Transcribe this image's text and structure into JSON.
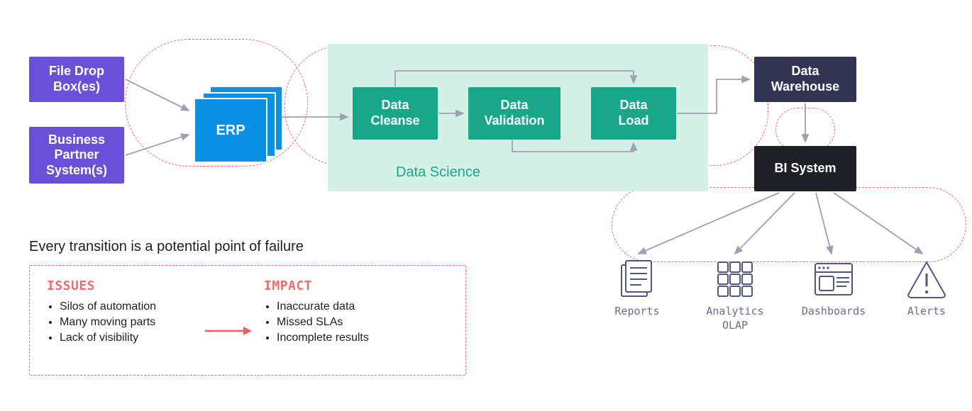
{
  "sources": {
    "file_drop": "File Drop\nBox(es)",
    "partner": "Business\nPartner\nSystem(s)"
  },
  "erp_label": "ERP",
  "data_science": {
    "region_label": "Data Science",
    "steps": {
      "cleanse": "Data\nCleanse",
      "validation": "Data\nValidation",
      "load": "Data\nLoad"
    }
  },
  "warehouse_label": "Data\nWarehouse",
  "bi_label": "BI System",
  "outputs": {
    "reports": "Reports",
    "analytics": "Analytics\nOLAP",
    "dashboards": "Dashboards",
    "alerts": "Alerts"
  },
  "caption": "Every transition is a potential point of failure",
  "issues": {
    "header": "ISSUES",
    "items": [
      "Silos of automation",
      "Many moving parts",
      "Lack of visibility"
    ]
  },
  "impact": {
    "header": "IMPACT",
    "items": [
      "Inaccurate data",
      "Missed SLAs",
      "Incomplete results"
    ]
  }
}
